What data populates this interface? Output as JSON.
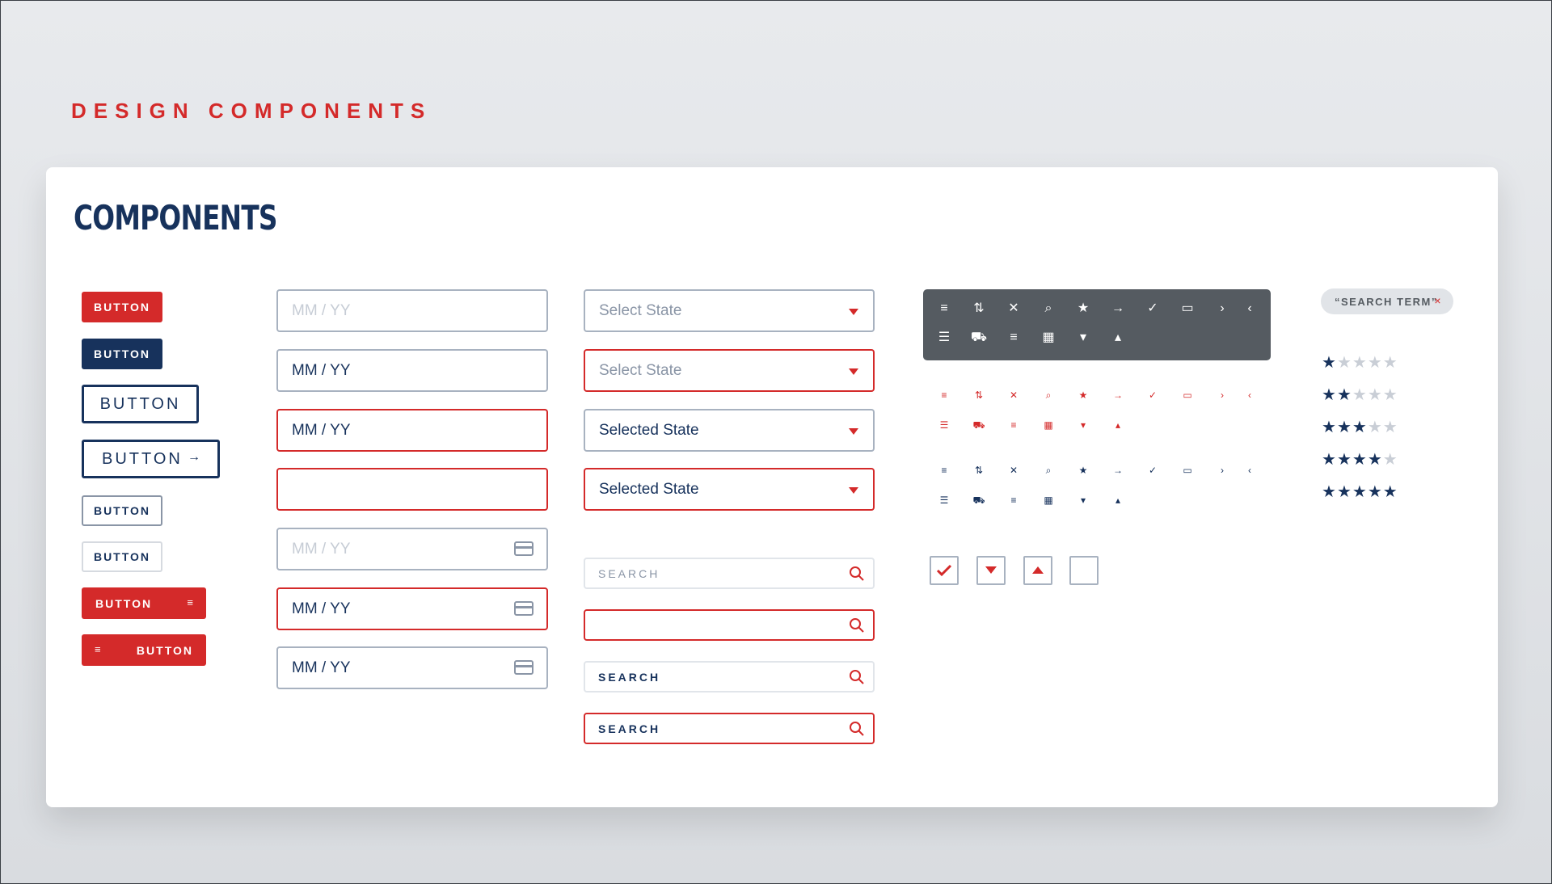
{
  "page_heading": "DESIGN COMPONENTS",
  "card_title": "COMPONENTS",
  "buttons": {
    "primary": "BUTTON",
    "navy": "BUTTON",
    "outline_large": "BUTTON",
    "outline_large_arrow": "BUTTON",
    "outline_small": "BUTTON",
    "outline_light": "BUTTON",
    "red_filter_right": "BUTTON",
    "red_filter_left": "BUTTON"
  },
  "date_fields": [
    {
      "value": "MM / YY",
      "state": "placeholder"
    },
    {
      "value": "MM / YY",
      "state": "filled"
    },
    {
      "value": "MM / YY",
      "state": "error"
    },
    {
      "value": "",
      "state": "error-empty"
    },
    {
      "value": "MM / YY",
      "state": "placeholder-card"
    },
    {
      "value": "MM / YY",
      "state": "error-card"
    },
    {
      "value": "MM / YY",
      "state": "filled-card"
    }
  ],
  "selects": [
    {
      "value": "Select State",
      "state": "placeholder"
    },
    {
      "value": "Select State",
      "state": "error-placeholder"
    },
    {
      "value": "Selected State",
      "state": "selected"
    },
    {
      "value": "Selected State",
      "state": "error-selected"
    }
  ],
  "searches": [
    {
      "value": "SEARCH",
      "state": "placeholder"
    },
    {
      "value": "",
      "state": "error-empty"
    },
    {
      "value": "SEARCH",
      "state": "filled"
    },
    {
      "value": "SEARCH",
      "state": "error-filled"
    }
  ],
  "icon_set": [
    "filter-icon",
    "sort-icon",
    "close-icon",
    "search-icon",
    "star-icon",
    "arrow-right-icon",
    "check-icon",
    "credit-card-icon",
    "chevron-right-icon",
    "chevron-left-icon",
    "list-icon",
    "cart-icon",
    "menu-icon",
    "calendar-icon",
    "caret-down-icon",
    "caret-up-icon"
  ],
  "chip": {
    "label": "“SEARCH TERM”",
    "close": "×"
  },
  "ratings": [
    1,
    2,
    3,
    4,
    5
  ],
  "rating_max": 5,
  "colors": {
    "red": "#d42a2a",
    "navy": "#17325c",
    "gray": "#555b61"
  }
}
